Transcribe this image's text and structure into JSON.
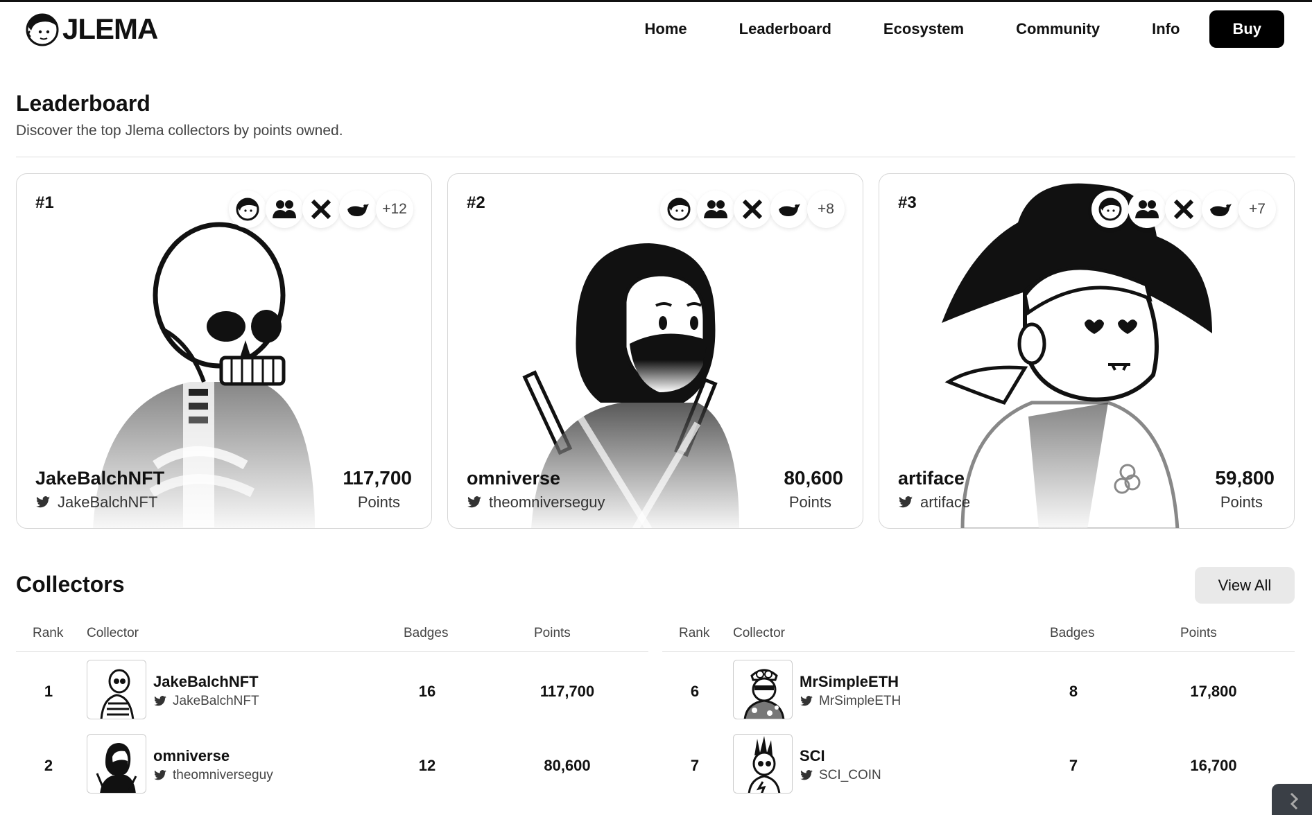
{
  "brand": {
    "name": "JLEMA"
  },
  "nav": {
    "items": [
      "Home",
      "Leaderboard",
      "Ecosystem",
      "Community",
      "Info"
    ],
    "buy": "Buy"
  },
  "page": {
    "title": "Leaderboard",
    "subtitle": "Discover the top Jlema collectors by points owned."
  },
  "podium": [
    {
      "rank": "#1",
      "name": "JakeBalchNFT",
      "handle": "JakeBalchNFT",
      "points": "117,700",
      "points_label": "Points",
      "more": "+12",
      "avatar": "skeleton"
    },
    {
      "rank": "#2",
      "name": "omniverse",
      "handle": "theomniverseguy",
      "points": "80,600",
      "points_label": "Points",
      "more": "+8",
      "avatar": "ninja"
    },
    {
      "rank": "#3",
      "name": "artiface",
      "handle": "artiface",
      "points": "59,800",
      "points_label": "Points",
      "more": "+7",
      "avatar": "pirate"
    }
  ],
  "badge_icons": [
    "face-icon",
    "group-icon",
    "x-icon",
    "whale-icon"
  ],
  "collectors": {
    "title": "Collectors",
    "view_all": "View All",
    "columns": [
      "Rank",
      "Collector",
      "Badges",
      "Points"
    ],
    "left": [
      {
        "rank": "1",
        "name": "JakeBalchNFT",
        "handle": "JakeBalchNFT",
        "badges": "16",
        "points": "117,700"
      },
      {
        "rank": "2",
        "name": "omniverse",
        "handle": "theomniverseguy",
        "badges": "12",
        "points": "80,600"
      }
    ],
    "right": [
      {
        "rank": "6",
        "name": "MrSimpleETH",
        "handle": "MrSimpleETH",
        "badges": "8",
        "points": "17,800"
      },
      {
        "rank": "7",
        "name": "SCI",
        "handle": "SCI_COIN",
        "badges": "7",
        "points": "16,700"
      }
    ]
  }
}
